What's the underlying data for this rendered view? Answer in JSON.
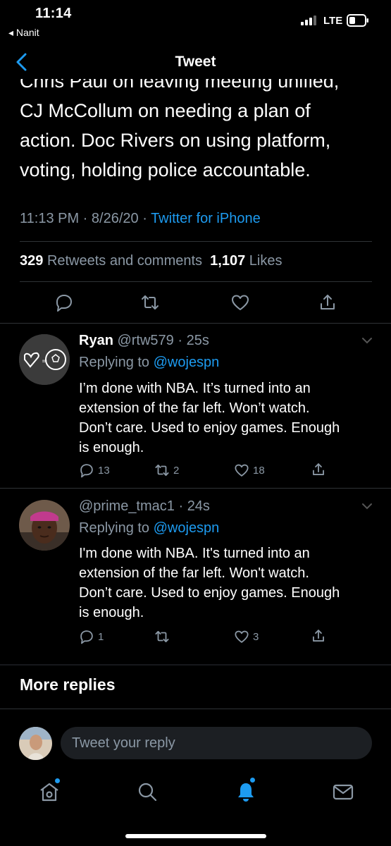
{
  "status_bar": {
    "time": "11:14",
    "back_app": "◂ Nanit",
    "network": "LTE"
  },
  "nav": {
    "title": "Tweet"
  },
  "tweet": {
    "top_clipped_line": "Chris Paul on leaving meeting unified,",
    "text_lines": [
      "CJ McCollum on needing a plan of",
      "action. Doc Rivers on using platform,",
      "voting, holding police accountable."
    ],
    "time": "11:13 PM",
    "date": "8/26/20",
    "client": "Twitter for iPhone",
    "retweets_count": "329",
    "retweets_label": "Retweets and comments",
    "likes_count": "1,107",
    "likes_label": "Likes"
  },
  "replies": [
    {
      "display_name": "Ryan",
      "handle": "@rtw579",
      "age": "25s",
      "replying_prefix": "Replying to",
      "replying_to": "@wojespn",
      "lines": [
        "I’m done with NBA. It’s turned into an",
        "extension of the far left. Won’t watch.",
        "Don’t care. Used to enjoy games. Enough",
        "is enough."
      ],
      "comments": "13",
      "retweets": "2",
      "likes": "18"
    },
    {
      "display_name": "",
      "handle": "@prime_tmac1",
      "age": "24s",
      "replying_prefix": "Replying to",
      "replying_to": "@wojespn",
      "lines": [
        "I'm done with NBA. It's turned into an",
        "extension of the far left. Won't watch.",
        "Don’t care. Used to enjoy games. Enough",
        "is enough."
      ],
      "comments": "1",
      "retweets": "",
      "likes": "3"
    }
  ],
  "more_replies_label": "More replies",
  "reply_box": {
    "placeholder": "Tweet your reply"
  },
  "colors": {
    "accent": "#1d9bf0",
    "muted": "#8b98a5",
    "background": "#000000",
    "divider": "#2f3336"
  },
  "icons": [
    "back-chevron",
    "comment",
    "retweet",
    "like",
    "share",
    "chevron-down",
    "home",
    "search",
    "notifications",
    "messages"
  ]
}
